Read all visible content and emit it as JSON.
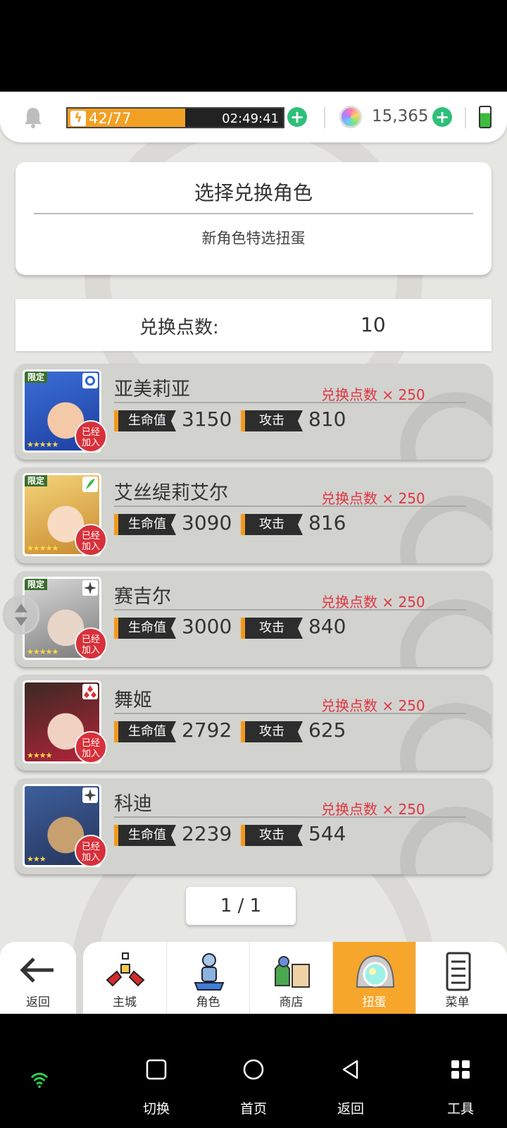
{
  "status_bar": {
    "stamina_text": "42/77",
    "stamina_fraction": 0.545,
    "stamina_timer": "02:49:41",
    "gem_count": "15,365"
  },
  "header": {
    "title": "选择兑换角色",
    "subtitle": "新角色特选扭蛋"
  },
  "points": {
    "label": "兑换点数:",
    "value": "10"
  },
  "labels": {
    "hp": "生命值",
    "attack": "攻击",
    "limited": "限定",
    "joined_line1": "已经",
    "joined_line2": "加入"
  },
  "characters": [
    {
      "name": "亚美莉亚",
      "cost": "兑换点数 × 250",
      "hp": "3150",
      "atk": "810",
      "stars": "★★★★★",
      "limited": true,
      "element_icon": "water-element-icon",
      "art_colors": [
        "#3b6fd6",
        "#1d3ea0",
        "#f4c9a8"
      ]
    },
    {
      "name": "艾丝缇莉艾尔",
      "cost": "兑换点数 × 250",
      "hp": "3090",
      "atk": "816",
      "stars": "★★★★★",
      "limited": true,
      "element_icon": "wind-element-icon",
      "art_colors": [
        "#f5d47a",
        "#c88a2e",
        "#f7dcc3"
      ]
    },
    {
      "name": "赛吉尔",
      "cost": "兑换点数 × 250",
      "hp": "3000",
      "atk": "840",
      "stars": "★★★★★",
      "limited": true,
      "element_icon": "dark-element-icon",
      "art_colors": [
        "#d9d9d9",
        "#7a7a7a",
        "#e8d6c8"
      ]
    },
    {
      "name": "舞姬",
      "cost": "兑换点数 × 250",
      "hp": "2792",
      "atk": "625",
      "stars": "★★★★",
      "limited": false,
      "element_icon": "fire-element-icon",
      "art_colors": [
        "#3a2a22",
        "#b5233a",
        "#f1d2c2"
      ]
    },
    {
      "name": "科迪",
      "cost": "兑换点数 × 250",
      "hp": "2239",
      "atk": "544",
      "stars": "★★★",
      "limited": false,
      "element_icon": "dark-element-icon",
      "art_colors": [
        "#3d5f9c",
        "#26355c",
        "#c8a070"
      ]
    }
  ],
  "pager": {
    "text": "1 / 1"
  },
  "nav": {
    "back": "返回",
    "tabs": [
      {
        "label": "主城",
        "icon": "castle-icon"
      },
      {
        "label": "角色",
        "icon": "character-icon"
      },
      {
        "label": "商店",
        "icon": "shop-icon"
      },
      {
        "label": "扭蛋",
        "icon": "gacha-icon",
        "active": true
      },
      {
        "label": "菜单",
        "icon": "menu-icon"
      }
    ]
  },
  "system_nav": {
    "switch": "切换",
    "home": "首页",
    "back": "返回",
    "tools": "工具"
  },
  "colors": {
    "accent_orange": "#f7a62c",
    "cost_red": "#e0353f",
    "plus_green": "#2fbf7a",
    "joined_red": "#d8303a"
  }
}
